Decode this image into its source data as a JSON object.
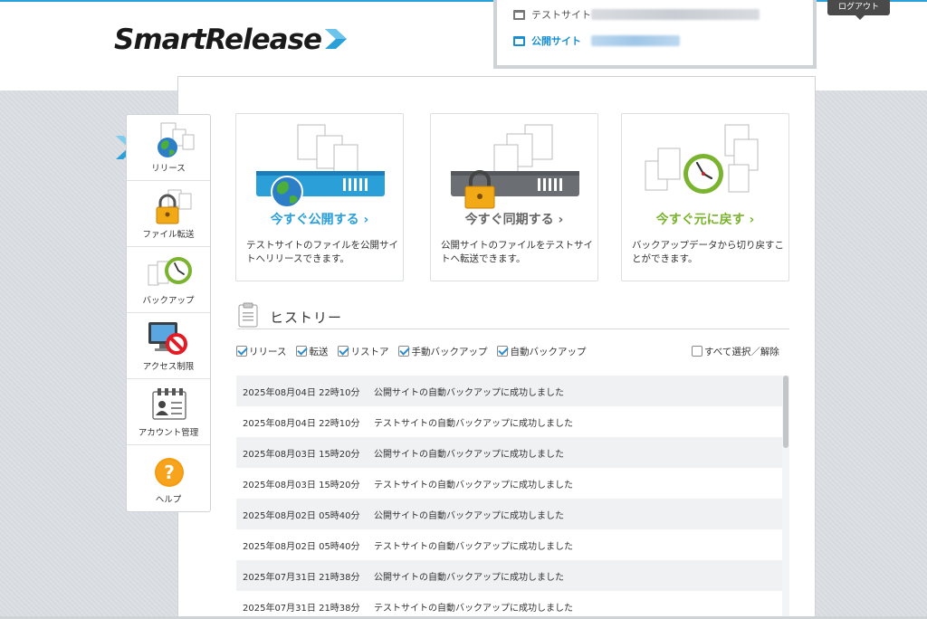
{
  "brand": {
    "logo_text": "SmartRelease",
    "accent": "#2a9fd8"
  },
  "header": {
    "logout_label": "ログアウト",
    "sites": [
      {
        "label": "テストサイト",
        "icon": "browser-window-icon"
      },
      {
        "label": "公開サイト",
        "icon": "browser-window-icon"
      }
    ]
  },
  "sidebar": {
    "items": [
      {
        "label": "リリース",
        "icon": "globe-icon"
      },
      {
        "label": "ファイル転送",
        "icon": "lock-icon"
      },
      {
        "label": "バックアップ",
        "icon": "clock-icon"
      },
      {
        "label": "アクセス制限",
        "icon": "monitor-forbidden-icon"
      },
      {
        "label": "アカウント管理",
        "icon": "account-card-icon"
      },
      {
        "label": "ヘルプ",
        "icon": "help-icon"
      }
    ]
  },
  "cards": [
    {
      "title": "今すぐ公開する ›",
      "desc": "テストサイトのファイルを公開サイトへリリースできます。",
      "color": "#2a9fd8"
    },
    {
      "title": "今すぐ同期する ›",
      "desc": "公開サイトのファイルをテストサイトへ転送できます。",
      "color": "#666666"
    },
    {
      "title": "今すぐ元に戻す ›",
      "desc": "バックアップデータから切り戻すことができます。",
      "color": "#7ab32e"
    }
  ],
  "history": {
    "title": "ヒストリー",
    "filters": [
      {
        "label": "リリース",
        "checked": true
      },
      {
        "label": "転送",
        "checked": true
      },
      {
        "label": "リストア",
        "checked": true
      },
      {
        "label": "手動バックアップ",
        "checked": true
      },
      {
        "label": "自動バックアップ",
        "checked": true
      }
    ],
    "select_all_label": "すべて選択／解除",
    "rows": [
      {
        "date": "2025年08月04日 22時10分",
        "message": "公開サイトの自動バックアップに成功しました"
      },
      {
        "date": "2025年08月04日 22時10分",
        "message": "テストサイトの自動バックアップに成功しました"
      },
      {
        "date": "2025年08月03日 15時20分",
        "message": "公開サイトの自動バックアップに成功しました"
      },
      {
        "date": "2025年08月03日 15時20分",
        "message": "テストサイトの自動バックアップに成功しました"
      },
      {
        "date": "2025年08月02日 05時40分",
        "message": "公開サイトの自動バックアップに成功しました"
      },
      {
        "date": "2025年08月02日 05時40分",
        "message": "テストサイトの自動バックアップに成功しました"
      },
      {
        "date": "2025年07月31日 21時38分",
        "message": "公開サイトの自動バックアップに成功しました"
      },
      {
        "date": "2025年07月31日 21時38分",
        "message": "テストサイトの自動バックアップに成功しました"
      }
    ]
  }
}
